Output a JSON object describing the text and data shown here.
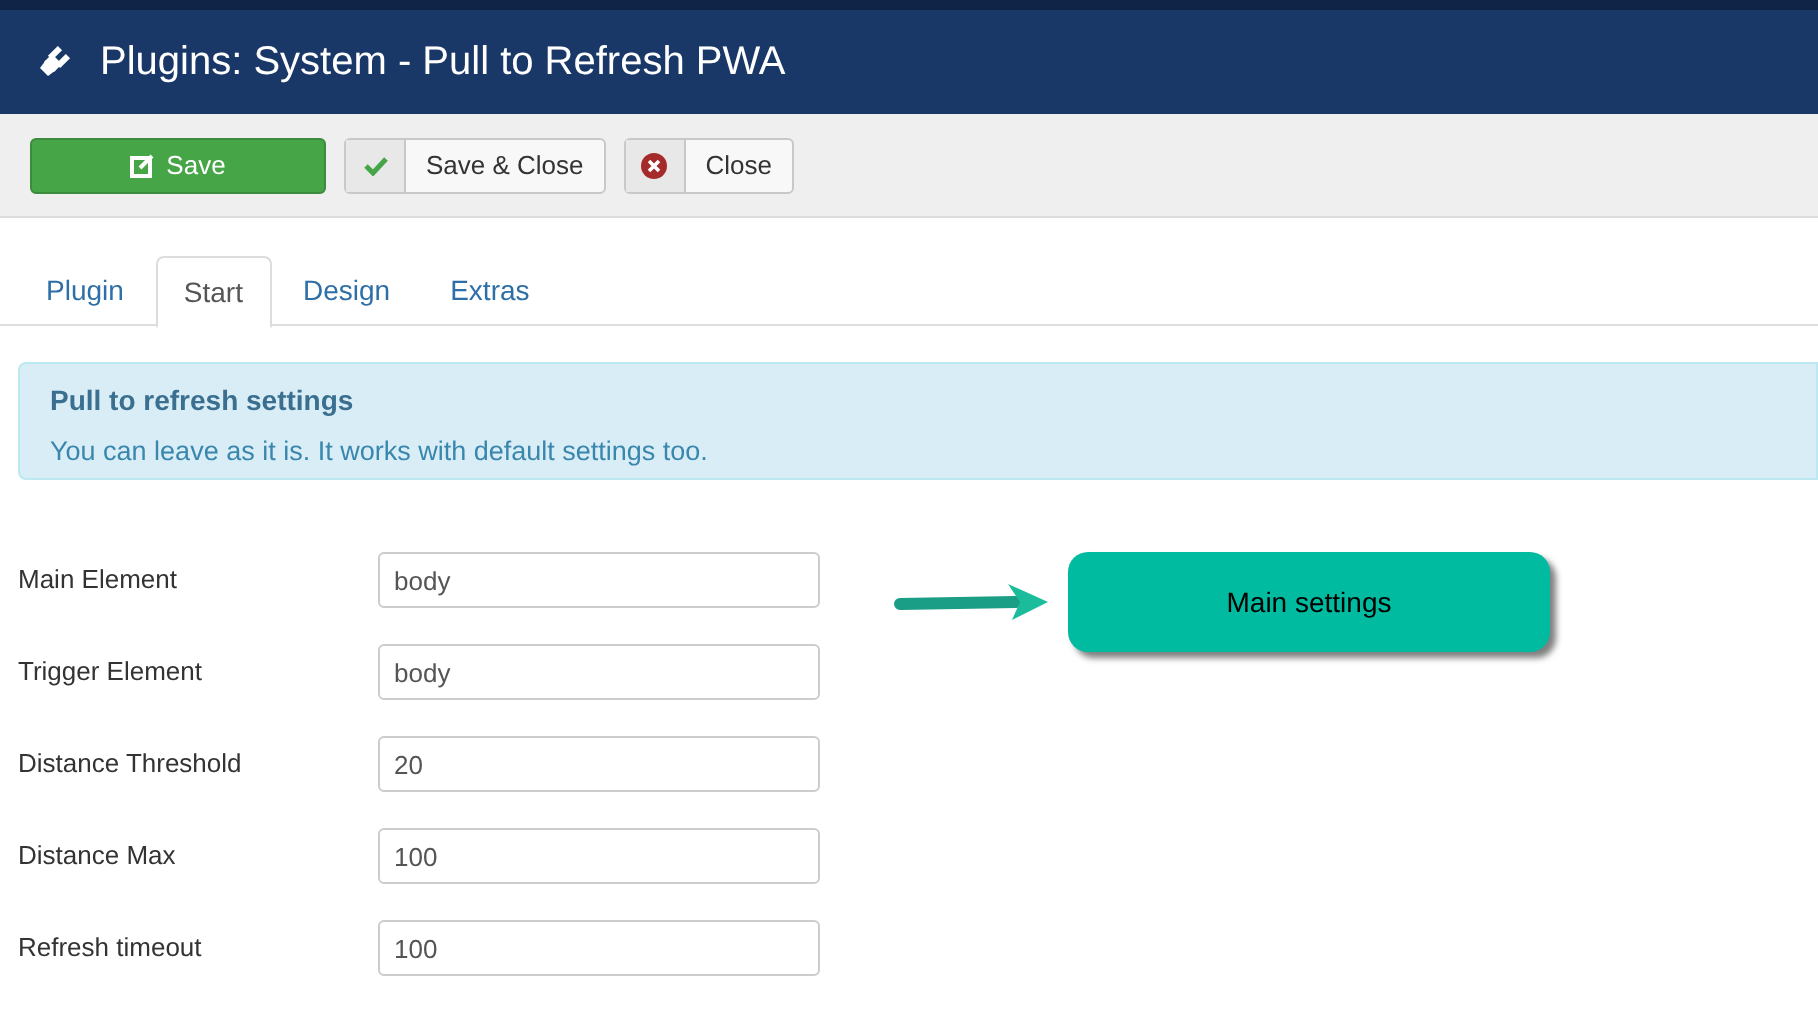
{
  "header": {
    "title": "Plugins: System - Pull to Refresh PWA"
  },
  "toolbar": [
    {
      "kind": "save",
      "label": "Save"
    },
    {
      "kind": "save-close",
      "label": "Save & Close"
    },
    {
      "kind": "close",
      "label": "Close"
    }
  ],
  "tabs": [
    {
      "label": "Plugin",
      "selected": false
    },
    {
      "label": "Start",
      "selected": true
    },
    {
      "label": "Design",
      "selected": false
    },
    {
      "label": "Extras",
      "selected": false
    }
  ],
  "alert": {
    "heading": "Pull to refresh settings",
    "text": "You can leave as it is. It works with default settings too."
  },
  "fields": [
    {
      "label": "Main Element",
      "value": "body"
    },
    {
      "label": "Trigger Element",
      "value": "body"
    },
    {
      "label": "Distance Threshold",
      "value": "20"
    },
    {
      "label": "Distance Max",
      "value": "100"
    },
    {
      "label": "Refresh timeout",
      "value": "100"
    }
  ],
  "callout": {
    "text": "Main settings"
  }
}
